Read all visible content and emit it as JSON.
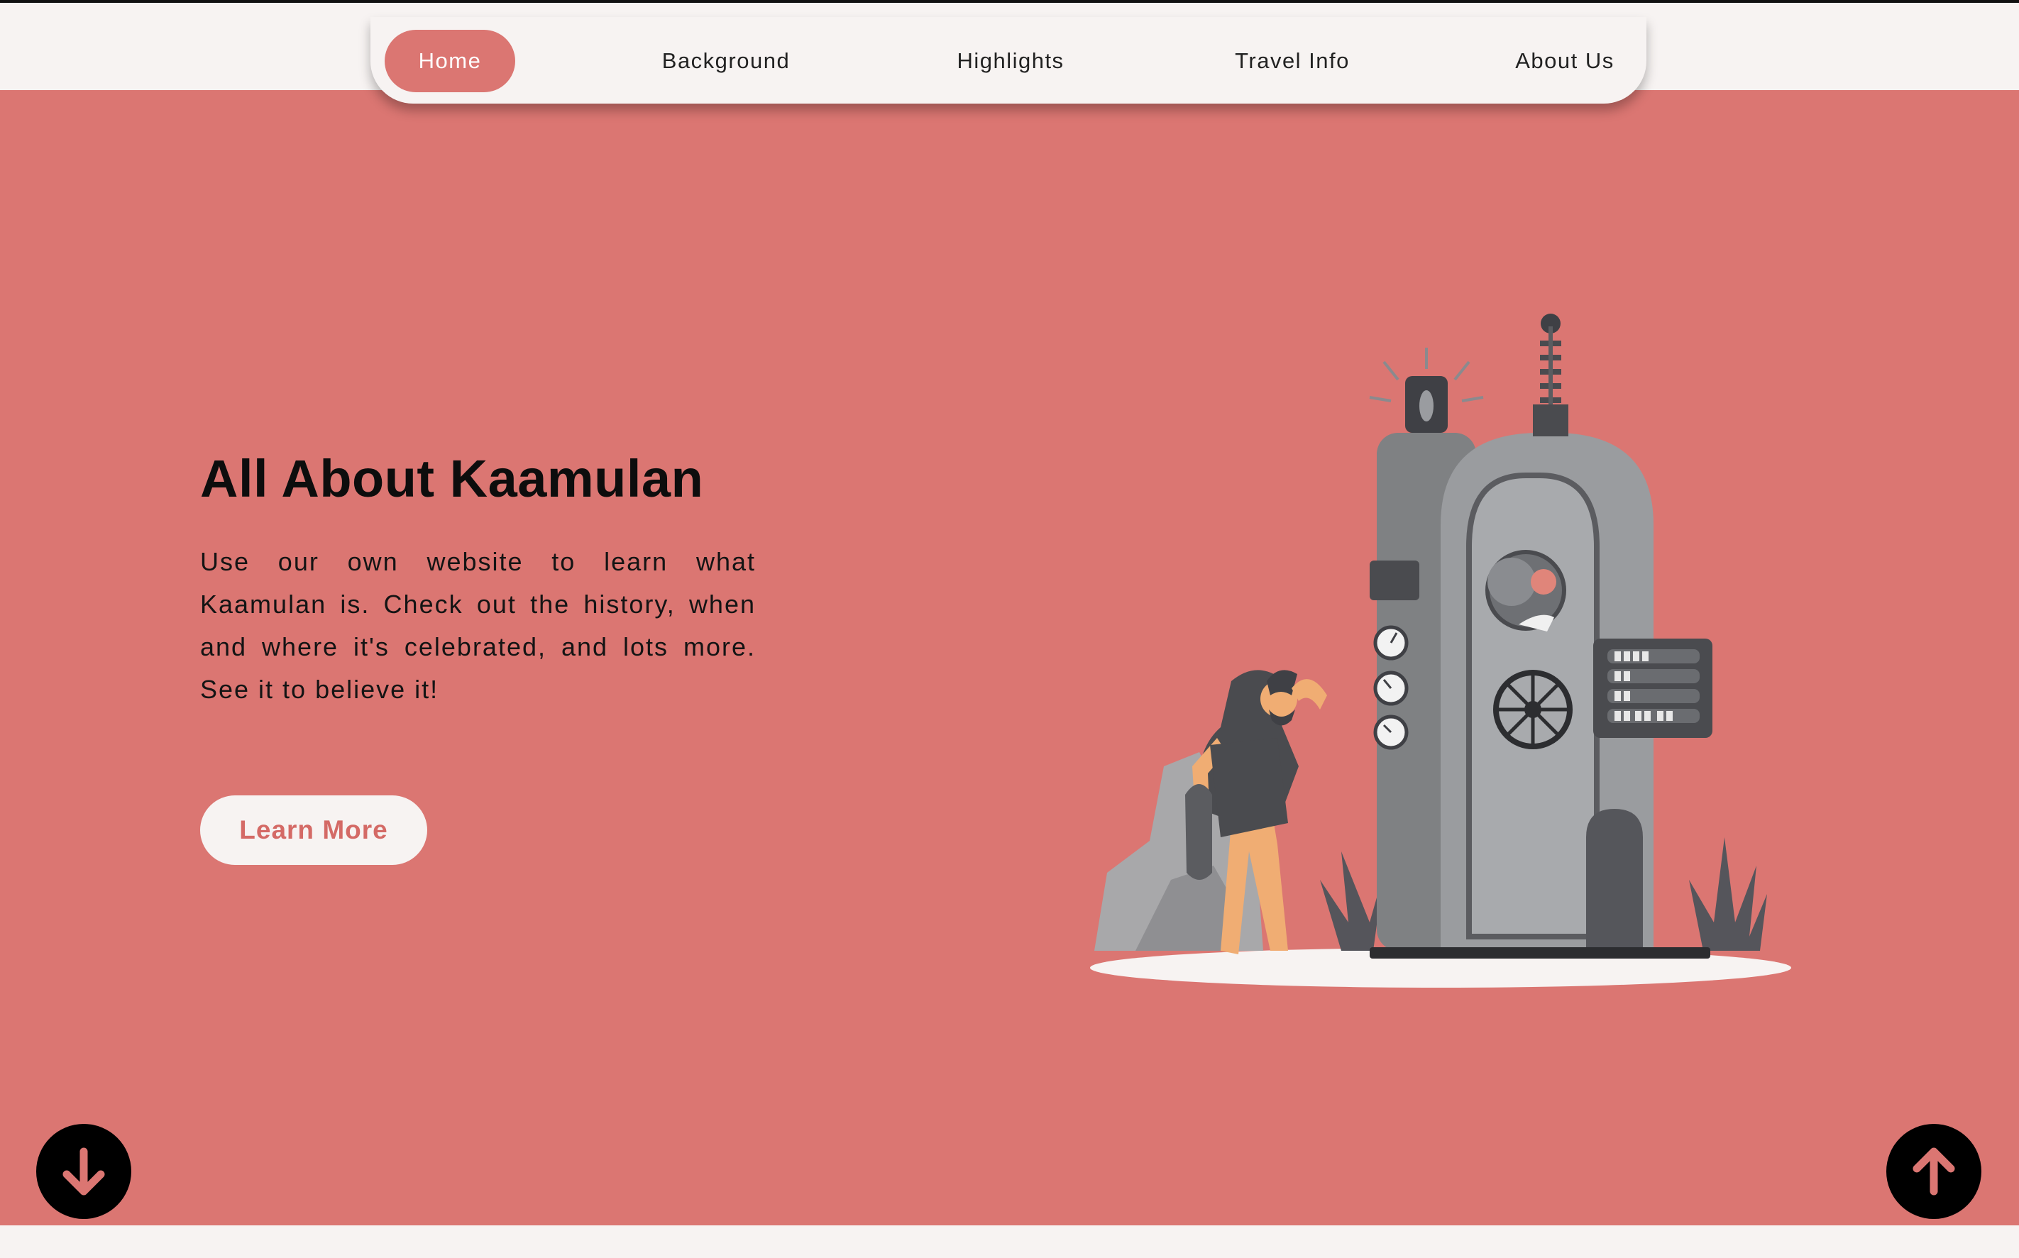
{
  "nav": {
    "items": [
      {
        "label": "Home",
        "active": true
      },
      {
        "label": "Background",
        "active": false
      },
      {
        "label": "Highlights",
        "active": false
      },
      {
        "label": "Travel Info",
        "active": false
      },
      {
        "label": "About Us",
        "active": false
      }
    ]
  },
  "hero": {
    "title": "All About Kaamulan",
    "description": "Use our own website to learn what Kaamulan is. Check out the history, when and where it's celebrated, and lots more. See it to believe it!",
    "cta_label": "Learn More"
  },
  "illustration": {
    "icon": "caveman-time-machine-illustration"
  },
  "buttons": {
    "scroll_down_icon": "arrow-down-icon",
    "scroll_up_icon": "arrow-up-icon"
  },
  "colors": {
    "accent": "#db7672",
    "background_light": "#f7f3f2",
    "text_dark": "#0d0d0d"
  }
}
